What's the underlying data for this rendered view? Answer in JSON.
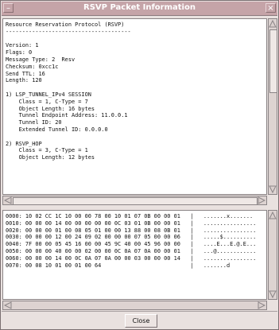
{
  "window": {
    "title": "RSVP Packet Information",
    "menu_icon": "window-menu-icon",
    "close_icon": "close-icon"
  },
  "details": {
    "lines": [
      "Resource Reservation Protocol (RSVP)",
      "--------------------------------------",
      "",
      "Version: 1",
      "Flags: 0",
      "Message Type: 2  Resv",
      "Checksum: 0xcc1c",
      "Send TTL: 16",
      "Length: 120",
      "",
      "1) LSP_TUNNEL_IPv4 SESSION",
      "    Class = 1, C-Type = 7",
      "    Object Length: 16 bytes",
      "    Tunnel Endpoint Address: 11.0.0.1",
      "    Tunnel ID: 20",
      "    Extended Tunnel ID: 0.0.0.0",
      "",
      "2) RSVP_HOP",
      "    Class = 3, C-Type = 1",
      "    Object Length: 12 bytes"
    ]
  },
  "hexdump": {
    "rows": [
      "0000: 10 02 CC 1C 10 00 00 78 00 10 01 07 0B 00 00 01   |   .......x.......",
      "0010: 00 00 00 14 00 00 00 00 00 0C 03 01 0B 00 00 01   |   ................",
      "0020: 00 00 00 01 00 08 05 01 00 00 13 88 00 08 0B 01   |   ................",
      "0030: 00 00 00 12 00 24 09 02 00 00 00 07 05 00 00 06   |   .....$..........",
      "0040: 7F 00 00 05 45 16 00 00 45 9C 40 00 45 96 00 00   |   ....E...E.@.E...",
      "0050: 00 00 00 40 00 00 02 00 00 0C 0A 07 0A 00 00 01   |   ...@............",
      "0060: 00 00 00 14 00 0C 0A 07 0A 00 00 03 00 00 00 14   |   ................",
      "0070: 00 08 10 01 00 01 00 64                           |   .......d"
    ]
  },
  "buttons": {
    "close_label": "Close"
  },
  "colors": {
    "titlebar": "#c5a4a8",
    "background": "#e9e1df"
  }
}
